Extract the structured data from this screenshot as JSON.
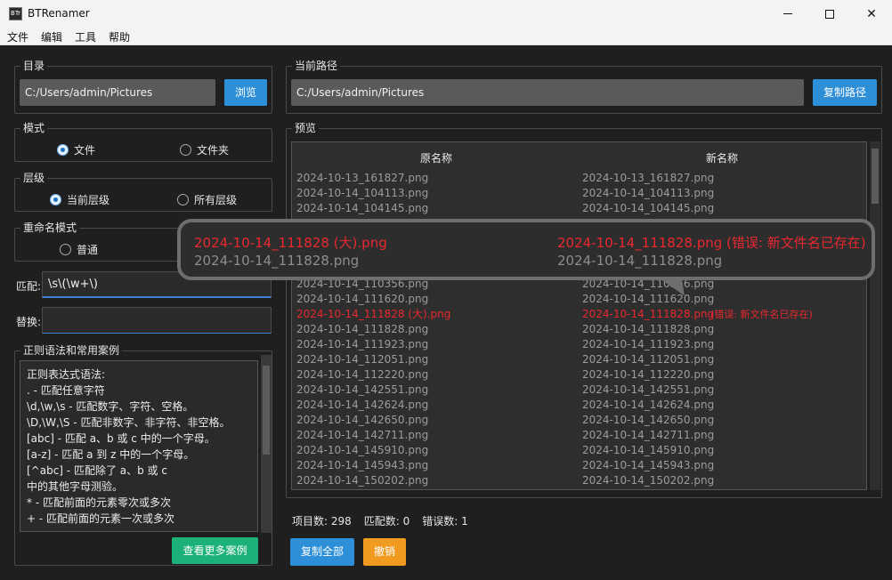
{
  "app": {
    "title": "BTRenamer",
    "icon_text": "BTr"
  },
  "window_controls": {
    "minimize": "minimize-icon",
    "maximize": "maximize-icon",
    "close": "✕"
  },
  "menu": [
    "文件",
    "编辑",
    "工具",
    "帮助"
  ],
  "directory": {
    "label": "目录",
    "value": "C:/Users/admin/Pictures",
    "browse_label": "浏览"
  },
  "current_path": {
    "label": "当前路径",
    "value": "C:/Users/admin/Pictures",
    "copy_label": "复制路径"
  },
  "mode": {
    "label": "模式",
    "options": [
      "文件",
      "文件夹"
    ],
    "selected": "文件"
  },
  "level": {
    "label": "层级",
    "options": [
      "当前层级",
      "所有层级"
    ],
    "selected": "当前层级"
  },
  "rename_mode": {
    "label": "重命名模式",
    "options": [
      "普通"
    ],
    "selected": "none"
  },
  "match": {
    "label": "匹配:",
    "value": "\\s\\(\\w+\\)"
  },
  "replace": {
    "label": "替换:",
    "value": ""
  },
  "regex_help": {
    "label": "正则语法和常用案例",
    "lines": [
      "正则表达式语法:",
      ". - 匹配任意字符",
      "\\d,\\w,\\s - 匹配数字、字符、空格。",
      "\\D,\\W,\\S - 匹配非数字、非字符、非空格。",
      "[abc] - 匹配 a、b 或 c 中的一个字母。",
      "[a-z] - 匹配 a 到 z 中的一个字母。",
      "[^abc] - 匹配除了 a、b 或 c",
      "中的其他字母测验。",
      "",
      "* - 匹配前面的元素零次或多次",
      "+ - 匹配前面的元素一次或多次"
    ],
    "more_label": "查看更多案例"
  },
  "preview": {
    "label": "预览",
    "col_original": "原名称",
    "col_new": "新名称",
    "rows": [
      {
        "old": "2024-10-13_161827.png",
        "new": "2024-10-13_161827.png",
        "error": ""
      },
      {
        "old": "2024-10-14_104113.png",
        "new": "2024-10-14_104113.png",
        "error": ""
      },
      {
        "old": "2024-10-14_104145.png",
        "new": "2024-10-14_104145.png",
        "error": ""
      },
      {
        "old": "",
        "new": "",
        "error": ""
      },
      {
        "old": "",
        "new": "",
        "error": ""
      },
      {
        "old": "",
        "new": "",
        "error": ""
      },
      {
        "old": "",
        "new": "",
        "error": ""
      },
      {
        "old": "2024-10-14_110356.png",
        "new": "2024-10-14_110356.png",
        "error": ""
      },
      {
        "old": "2024-10-14_111620.png",
        "new": "2024-10-14_111620.png",
        "error": ""
      },
      {
        "old": "2024-10-14_111828 (大).png",
        "new": "2024-10-14_111828.png",
        "error": "(错误: 新文件名已存在)"
      },
      {
        "old": "2024-10-14_111828.png",
        "new": "2024-10-14_111828.png",
        "error": ""
      },
      {
        "old": "2024-10-14_111923.png",
        "new": "2024-10-14_111923.png",
        "error": ""
      },
      {
        "old": "2024-10-14_112051.png",
        "new": "2024-10-14_112051.png",
        "error": ""
      },
      {
        "old": "2024-10-14_112220.png",
        "new": "2024-10-14_112220.png",
        "error": ""
      },
      {
        "old": "2024-10-14_142551.png",
        "new": "2024-10-14_142551.png",
        "error": ""
      },
      {
        "old": "2024-10-14_142624.png",
        "new": "2024-10-14_142624.png",
        "error": ""
      },
      {
        "old": "2024-10-14_142650.png",
        "new": "2024-10-14_142650.png",
        "error": ""
      },
      {
        "old": "2024-10-14_142711.png",
        "new": "2024-10-14_142711.png",
        "error": ""
      },
      {
        "old": "2024-10-14_145910.png",
        "new": "2024-10-14_145910.png",
        "error": ""
      },
      {
        "old": "2024-10-14_145943.png",
        "new": "2024-10-14_145943.png",
        "error": ""
      },
      {
        "old": "2024-10-14_150202.png",
        "new": "2024-10-14_150202.png",
        "error": ""
      }
    ]
  },
  "zoom_tooltip": {
    "line1_old": "2024-10-14_111828 (大).png",
    "line1_new": "2024-10-14_111828.png (错误: 新文件名已存在)",
    "line2_old": "2024-10-14_111828.png",
    "line2_new": "2024-10-14_111828.png"
  },
  "stats": {
    "items": "项目数: 298",
    "matches": "匹配数: 0",
    "errors": "错误数: 1"
  },
  "actions": {
    "copy_all": "复制全部",
    "undo": "撤销"
  },
  "colors": {
    "accent_blue": "#2d8fd8",
    "green": "#1db17a",
    "orange": "#f09a20",
    "error_red": "#e8282f"
  }
}
